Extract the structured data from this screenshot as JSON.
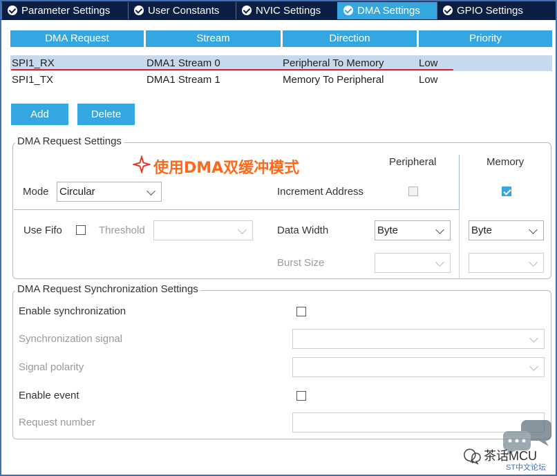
{
  "tabs": [
    {
      "label": "Parameter Settings",
      "active": false
    },
    {
      "label": "User Constants",
      "active": false
    },
    {
      "label": "NVIC Settings",
      "active": false
    },
    {
      "label": "DMA Settings",
      "active": true
    },
    {
      "label": "GPIO Settings",
      "active": false
    }
  ],
  "table": {
    "headers": [
      "DMA Request",
      "Stream",
      "Direction",
      "Priority"
    ],
    "rows": [
      {
        "request": "SPI1_RX",
        "stream": "DMA1 Stream 0",
        "direction": "Peripheral To Memory",
        "priority": "Low",
        "selected": true
      },
      {
        "request": "SPI1_TX",
        "stream": "DMA1 Stream 1",
        "direction": "Memory To Peripheral",
        "priority": "Low",
        "selected": false
      }
    ]
  },
  "buttons": {
    "add": "Add",
    "delete": "Delete"
  },
  "request_settings": {
    "title": "DMA Request Settings",
    "annotation": "使用DMA双缓冲模式",
    "peripheral_header": "Peripheral",
    "memory_header": "Memory",
    "mode_label": "Mode",
    "mode_value": "Circular",
    "increment_label": "Increment Address",
    "peripheral_increment": false,
    "memory_increment": true,
    "use_fifo_label": "Use Fifo",
    "use_fifo": false,
    "threshold_label": "Threshold",
    "threshold_value": "",
    "data_width_label": "Data Width",
    "peripheral_data_width": "Byte",
    "memory_data_width": "Byte",
    "burst_size_label": "Burst Size",
    "peripheral_burst": "",
    "memory_burst": ""
  },
  "sync_settings": {
    "title": "DMA Request Synchronization Settings",
    "enable_sync_label": "Enable synchronization",
    "enable_sync": false,
    "sync_signal_label": "Synchronization signal",
    "sync_signal_value": "",
    "signal_polarity_label": "Signal polarity",
    "signal_polarity_value": "",
    "enable_event_label": "Enable event",
    "enable_event": false,
    "request_number_label": "Request number",
    "request_number_value": ""
  },
  "watermark": {
    "name": "茶话MCU",
    "sub": "ST中文论坛"
  },
  "colors": {
    "tab_bar": "#0b1f44",
    "accent": "#35a7e0",
    "selection": "#c7d9ec",
    "annotation": "#ff6a1a",
    "underline": "#d8232a"
  }
}
